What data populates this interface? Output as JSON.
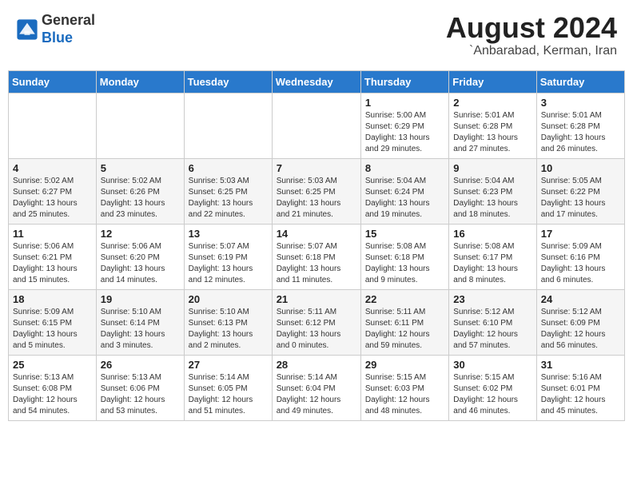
{
  "header": {
    "logo_general": "General",
    "logo_blue": "Blue",
    "month_year": "August 2024",
    "location": "`Anbarabad, Kerman, Iran"
  },
  "weekdays": [
    "Sunday",
    "Monday",
    "Tuesday",
    "Wednesday",
    "Thursday",
    "Friday",
    "Saturday"
  ],
  "weeks": [
    [
      {
        "day": "",
        "content": ""
      },
      {
        "day": "",
        "content": ""
      },
      {
        "day": "",
        "content": ""
      },
      {
        "day": "",
        "content": ""
      },
      {
        "day": "1",
        "content": "Sunrise: 5:00 AM\nSunset: 6:29 PM\nDaylight: 13 hours\nand 29 minutes."
      },
      {
        "day": "2",
        "content": "Sunrise: 5:01 AM\nSunset: 6:28 PM\nDaylight: 13 hours\nand 27 minutes."
      },
      {
        "day": "3",
        "content": "Sunrise: 5:01 AM\nSunset: 6:28 PM\nDaylight: 13 hours\nand 26 minutes."
      }
    ],
    [
      {
        "day": "4",
        "content": "Sunrise: 5:02 AM\nSunset: 6:27 PM\nDaylight: 13 hours\nand 25 minutes."
      },
      {
        "day": "5",
        "content": "Sunrise: 5:02 AM\nSunset: 6:26 PM\nDaylight: 13 hours\nand 23 minutes."
      },
      {
        "day": "6",
        "content": "Sunrise: 5:03 AM\nSunset: 6:25 PM\nDaylight: 13 hours\nand 22 minutes."
      },
      {
        "day": "7",
        "content": "Sunrise: 5:03 AM\nSunset: 6:25 PM\nDaylight: 13 hours\nand 21 minutes."
      },
      {
        "day": "8",
        "content": "Sunrise: 5:04 AM\nSunset: 6:24 PM\nDaylight: 13 hours\nand 19 minutes."
      },
      {
        "day": "9",
        "content": "Sunrise: 5:04 AM\nSunset: 6:23 PM\nDaylight: 13 hours\nand 18 minutes."
      },
      {
        "day": "10",
        "content": "Sunrise: 5:05 AM\nSunset: 6:22 PM\nDaylight: 13 hours\nand 17 minutes."
      }
    ],
    [
      {
        "day": "11",
        "content": "Sunrise: 5:06 AM\nSunset: 6:21 PM\nDaylight: 13 hours\nand 15 minutes."
      },
      {
        "day": "12",
        "content": "Sunrise: 5:06 AM\nSunset: 6:20 PM\nDaylight: 13 hours\nand 14 minutes."
      },
      {
        "day": "13",
        "content": "Sunrise: 5:07 AM\nSunset: 6:19 PM\nDaylight: 13 hours\nand 12 minutes."
      },
      {
        "day": "14",
        "content": "Sunrise: 5:07 AM\nSunset: 6:18 PM\nDaylight: 13 hours\nand 11 minutes."
      },
      {
        "day": "15",
        "content": "Sunrise: 5:08 AM\nSunset: 6:18 PM\nDaylight: 13 hours\nand 9 minutes."
      },
      {
        "day": "16",
        "content": "Sunrise: 5:08 AM\nSunset: 6:17 PM\nDaylight: 13 hours\nand 8 minutes."
      },
      {
        "day": "17",
        "content": "Sunrise: 5:09 AM\nSunset: 6:16 PM\nDaylight: 13 hours\nand 6 minutes."
      }
    ],
    [
      {
        "day": "18",
        "content": "Sunrise: 5:09 AM\nSunset: 6:15 PM\nDaylight: 13 hours\nand 5 minutes."
      },
      {
        "day": "19",
        "content": "Sunrise: 5:10 AM\nSunset: 6:14 PM\nDaylight: 13 hours\nand 3 minutes."
      },
      {
        "day": "20",
        "content": "Sunrise: 5:10 AM\nSunset: 6:13 PM\nDaylight: 13 hours\nand 2 minutes."
      },
      {
        "day": "21",
        "content": "Sunrise: 5:11 AM\nSunset: 6:12 PM\nDaylight: 13 hours\nand 0 minutes."
      },
      {
        "day": "22",
        "content": "Sunrise: 5:11 AM\nSunset: 6:11 PM\nDaylight: 12 hours\nand 59 minutes."
      },
      {
        "day": "23",
        "content": "Sunrise: 5:12 AM\nSunset: 6:10 PM\nDaylight: 12 hours\nand 57 minutes."
      },
      {
        "day": "24",
        "content": "Sunrise: 5:12 AM\nSunset: 6:09 PM\nDaylight: 12 hours\nand 56 minutes."
      }
    ],
    [
      {
        "day": "25",
        "content": "Sunrise: 5:13 AM\nSunset: 6:08 PM\nDaylight: 12 hours\nand 54 minutes."
      },
      {
        "day": "26",
        "content": "Sunrise: 5:13 AM\nSunset: 6:06 PM\nDaylight: 12 hours\nand 53 minutes."
      },
      {
        "day": "27",
        "content": "Sunrise: 5:14 AM\nSunset: 6:05 PM\nDaylight: 12 hours\nand 51 minutes."
      },
      {
        "day": "28",
        "content": "Sunrise: 5:14 AM\nSunset: 6:04 PM\nDaylight: 12 hours\nand 49 minutes."
      },
      {
        "day": "29",
        "content": "Sunrise: 5:15 AM\nSunset: 6:03 PM\nDaylight: 12 hours\nand 48 minutes."
      },
      {
        "day": "30",
        "content": "Sunrise: 5:15 AM\nSunset: 6:02 PM\nDaylight: 12 hours\nand 46 minutes."
      },
      {
        "day": "31",
        "content": "Sunrise: 5:16 AM\nSunset: 6:01 PM\nDaylight: 12 hours\nand 45 minutes."
      }
    ]
  ]
}
